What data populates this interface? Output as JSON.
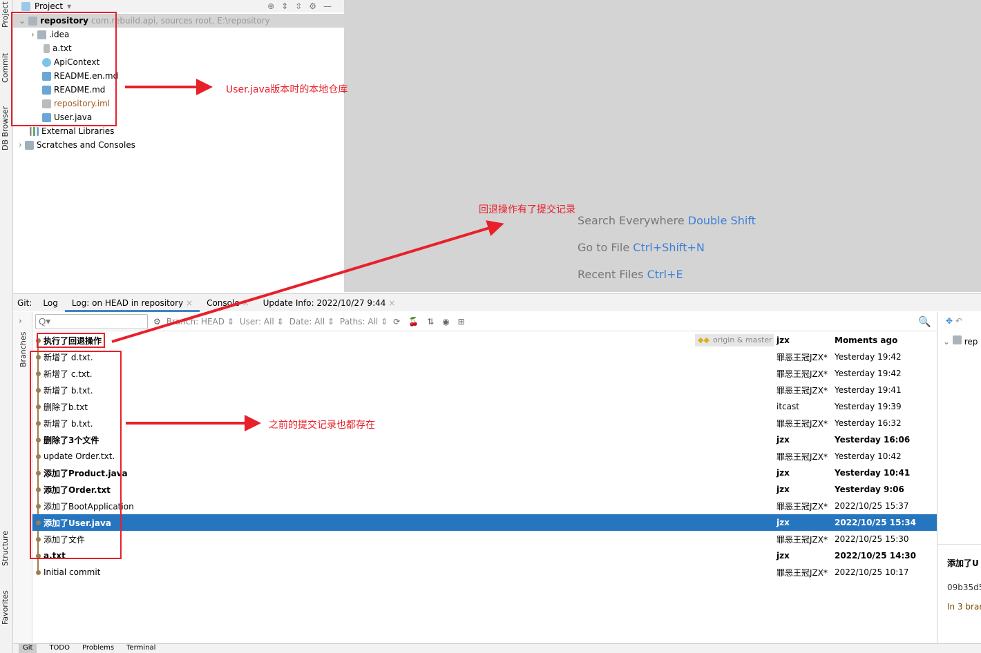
{
  "sidebar_left": {
    "top": [
      "Project",
      "Commit",
      "DB Browser"
    ],
    "bottom": [
      "Structure",
      "Favorites"
    ],
    "branches": "Branches"
  },
  "project": {
    "title": "Project",
    "root": "repository",
    "root_hint": "com.rebuild.api,  sources root,  E:\\repository",
    "items": [
      ".idea",
      "a.txt",
      "ApiContext",
      "README.en.md",
      "README.md",
      "repository.iml",
      "User.java"
    ],
    "external": "External Libraries",
    "scratches": "Scratches and Consoles"
  },
  "editor": {
    "hints": [
      {
        "text": "Search Everywhere ",
        "key": "Double Shift"
      },
      {
        "text": "Go to File ",
        "key": "Ctrl+Shift+N"
      },
      {
        "text": "Recent Files ",
        "key": "Ctrl+E"
      }
    ]
  },
  "git": {
    "label": "Git:",
    "tabs": [
      "Log",
      "Log: on HEAD in repository",
      "Console",
      "Update Info: 2022/10/27 9:44"
    ],
    "search_placeholder": "Q▾",
    "filters": [
      "Branch: HEAD ⇕",
      "User: All ⇕",
      "Date: All ⇕",
      "Paths: All ⇕"
    ],
    "ref_label": "origin & master",
    "commits": [
      {
        "msg": "执行了回退操作",
        "author": "jzx",
        "date": "Moments ago",
        "bold": true
      },
      {
        "msg": "新增了 d.txt.",
        "author": "罪恶王冠JZX*",
        "date": "Yesterday 19:42"
      },
      {
        "msg": "新增了 c.txt.",
        "author": "罪恶王冠JZX*",
        "date": "Yesterday 19:42"
      },
      {
        "msg": "新增了 b.txt.",
        "author": "罪恶王冠JZX*",
        "date": "Yesterday 19:41"
      },
      {
        "msg": "删除了b.txt",
        "author": "itcast",
        "date": "Yesterday 19:39"
      },
      {
        "msg": "新增了 b.txt.",
        "author": "罪恶王冠JZX*",
        "date": "Yesterday 16:32"
      },
      {
        "msg": "删除了3个文件",
        "author": "jzx",
        "date": "Yesterday 16:06",
        "bold": true
      },
      {
        "msg": "update Order.txt.",
        "author": "罪恶王冠JZX*",
        "date": "Yesterday 10:42"
      },
      {
        "msg": "添加了Product.java",
        "author": "jzx",
        "date": "Yesterday 10:41",
        "bold": true
      },
      {
        "msg": "添加了Order.txt",
        "author": "jzx",
        "date": "Yesterday 9:06",
        "bold": true
      },
      {
        "msg": "添加了BootApplication",
        "author": "罪恶王冠JZX*",
        "date": "2022/10/25 15:37"
      },
      {
        "msg": "添加了User.java",
        "author": "jzx",
        "date": "2022/10/25 15:34",
        "bold": true,
        "selected": true
      },
      {
        "msg": "添加了文件",
        "author": "罪恶王冠JZX*",
        "date": "2022/10/25 15:30"
      },
      {
        "msg": "a.txt",
        "author": "jzx",
        "date": "2022/10/25 14:30",
        "bold": true
      },
      {
        "msg": "Initial commit",
        "author": "罪恶王冠JZX*",
        "date": "2022/10/25 10:17"
      }
    ]
  },
  "details": {
    "tree_root": "rep",
    "commit_msg": "添加了U",
    "hash": "09b35d5",
    "branches": "In 3 bran"
  },
  "bottom_tabs": [
    "Git",
    "TODO",
    "Problems",
    "Terminal"
  ],
  "annotations": [
    "User.java版本时的本地仓库",
    "回退操作有了提交记录",
    "之前的提交记录也都存在"
  ],
  "colors": {
    "accent": "#2675bf",
    "annotation": "#e8202a",
    "graph": "#9c7e4e"
  }
}
